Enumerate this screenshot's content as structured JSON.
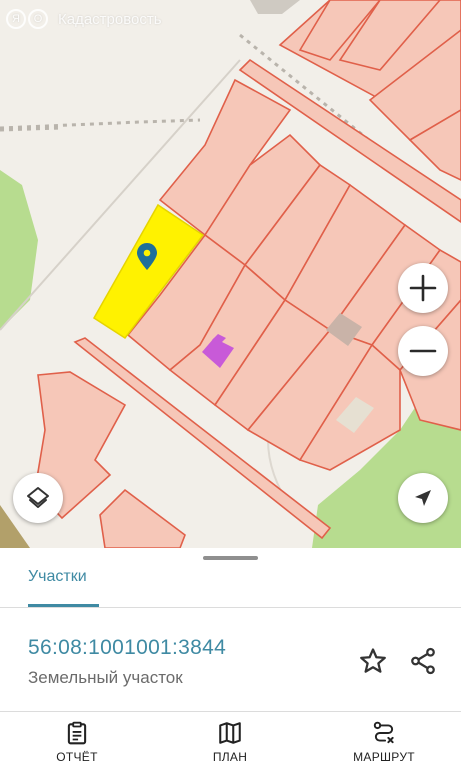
{
  "map": {
    "brand_name": "Кадастровость",
    "brand_logo": "ЯО",
    "colors": {
      "background": "#f2efe9",
      "parcel_fill": "#f6c7b8",
      "parcel_stroke": "#e0604a",
      "selected_parcel": "#fff200",
      "forest": "#b7dc8f",
      "marker": "#1f6f9a",
      "building": "#c85ad8",
      "building_gray": "#c9c0b4"
    },
    "controls": {
      "zoom_in_icon": "plus-icon",
      "zoom_out_icon": "minus-icon",
      "layers_icon": "layers-icon",
      "locate_icon": "navigation-arrow-icon"
    }
  },
  "sheet": {
    "tab_label": "Участки",
    "cadastral_number": "56:08:1001001:3844",
    "object_type": "Земельный участок",
    "favorite_icon": "star-icon",
    "share_icon": "share-icon"
  },
  "nav": {
    "items": [
      {
        "label": "ОТЧЁТ",
        "icon": "clipboard-icon"
      },
      {
        "label": "ПЛАН",
        "icon": "map-icon"
      },
      {
        "label": "МАРШРУТ",
        "icon": "route-icon"
      }
    ]
  },
  "accent_color": "#3f8aa3"
}
